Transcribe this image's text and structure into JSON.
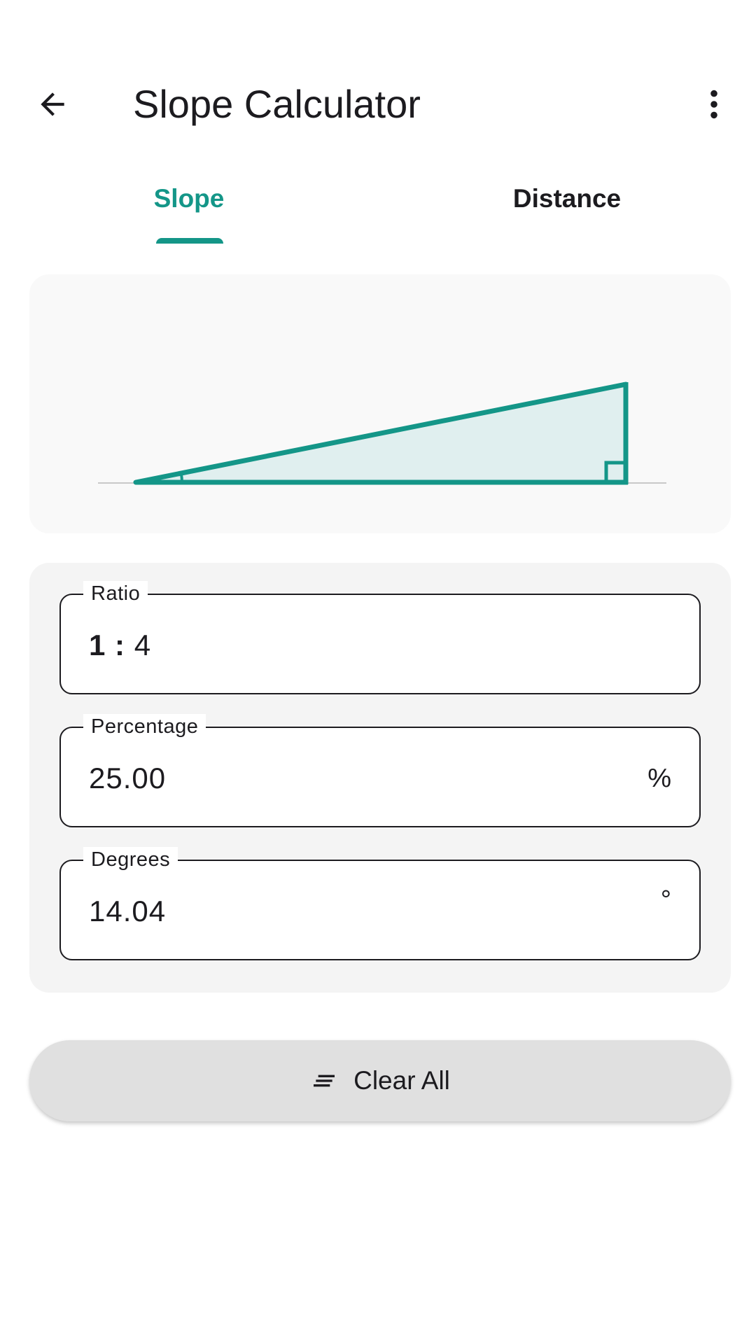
{
  "app_bar": {
    "title": "Slope Calculator",
    "back_icon": "arrow-left-icon",
    "menu_icon": "more-vert-icon"
  },
  "tabs": [
    {
      "label": "Slope",
      "active": true
    },
    {
      "label": "Distance",
      "active": false
    }
  ],
  "diagram": {
    "rise": 1,
    "run": 4
  },
  "fields": {
    "ratio": {
      "label": "Ratio",
      "prefix": "1 :",
      "value": "4"
    },
    "percentage": {
      "label": "Percentage",
      "value": "25.00",
      "suffix": "%"
    },
    "degrees": {
      "label": "Degrees",
      "value": "14.04",
      "suffix": "°"
    }
  },
  "actions": {
    "clear_label": "Clear All",
    "clear_icon": "clear-all-icon"
  },
  "colors": {
    "accent": "#149688",
    "triangle_fill": "#e0efef",
    "card_bg": "#f4f4f4",
    "button_bg": "#e0e0e0"
  }
}
